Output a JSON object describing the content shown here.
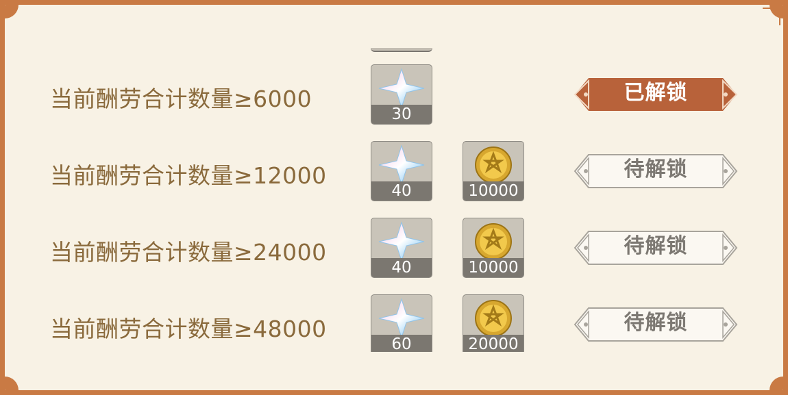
{
  "rows": [
    {
      "label": "当前酬劳合计数量≥6000",
      "rewards": [
        {
          "icon": "primogem-icon",
          "qty": "30"
        }
      ],
      "status": "已解锁",
      "unlocked": true
    },
    {
      "label": "当前酬劳合计数量≥12000",
      "rewards": [
        {
          "icon": "primogem-icon",
          "qty": "40"
        },
        {
          "icon": "mora-coin-icon",
          "qty": "10000"
        }
      ],
      "status": "待解锁",
      "unlocked": false
    },
    {
      "label": "当前酬劳合计数量≥24000",
      "rewards": [
        {
          "icon": "primogem-icon",
          "qty": "40"
        },
        {
          "icon": "mora-coin-icon",
          "qty": "10000"
        }
      ],
      "status": "待解锁",
      "unlocked": false
    },
    {
      "label": "当前酬劳合计数量≥48000",
      "rewards": [
        {
          "icon": "primogem-icon",
          "qty": "60"
        },
        {
          "icon": "mora-coin-icon",
          "qty": "20000"
        }
      ],
      "status": "待解锁",
      "unlocked": false
    }
  ],
  "colors": {
    "frame": "#c97a44",
    "panel": "#f8f2e5",
    "label": "#8a6a3c",
    "unlocked_badge": "#b8623a",
    "locked_text": "#7c7872"
  }
}
